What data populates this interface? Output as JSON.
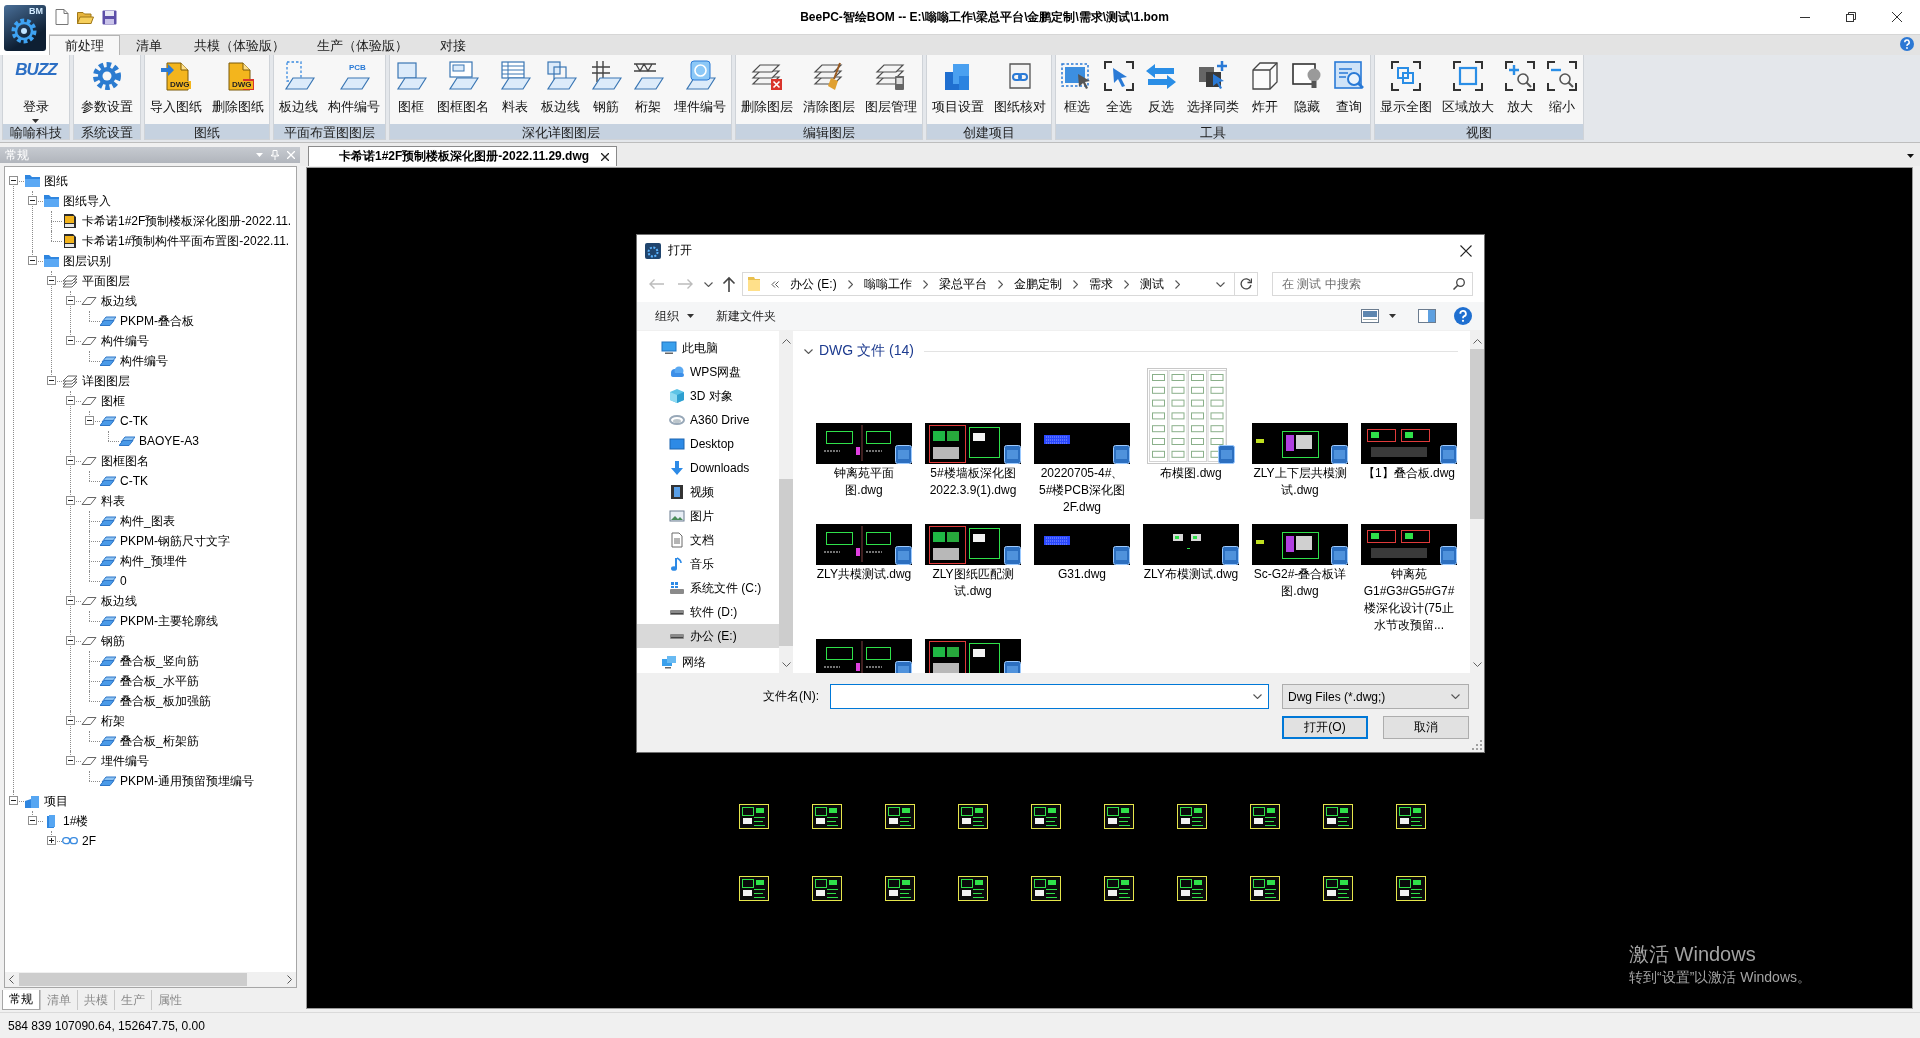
{
  "app": {
    "logo_text": "BM",
    "title": "BeePC-智绘BOM -- E:\\嗡嗡工作\\梁总平台\\金鹏定制\\需求\\测试\\1.bom"
  },
  "ribbon_tabs": [
    {
      "label": "前处理",
      "selected": true
    },
    {
      "label": "清单",
      "selected": false
    },
    {
      "label": "共模（体验版）",
      "selected": false
    },
    {
      "label": "生产（体验版）",
      "selected": false
    },
    {
      "label": "对接",
      "selected": false
    }
  ],
  "ribbon_groups": [
    {
      "label": "喻喻科技",
      "buttons": [
        {
          "label": "登录",
          "logo_text": "BUZZ",
          "menu": true
        }
      ]
    },
    {
      "label": "系统设置",
      "buttons": [
        {
          "label": "参数设置"
        }
      ]
    },
    {
      "label": "图纸",
      "buttons": [
        {
          "label": "导入图纸",
          "icon_text": "DWG"
        },
        {
          "label": "删除图纸",
          "icon_text": "DWG"
        }
      ]
    },
    {
      "label": "平面布置图图层",
      "buttons": [
        {
          "label": "板边线"
        },
        {
          "label": "构件编号",
          "icon_text": "PCB"
        }
      ]
    },
    {
      "label": "深化详图图层",
      "buttons": [
        {
          "label": "图框"
        },
        {
          "label": "图框图名"
        },
        {
          "label": "料表"
        },
        {
          "label": "板边线"
        },
        {
          "label": "钢筋"
        },
        {
          "label": "桁架"
        },
        {
          "label": "埋件编号"
        }
      ]
    },
    {
      "label": "编辑图层",
      "buttons": [
        {
          "label": "删除图层"
        },
        {
          "label": "清除图层"
        },
        {
          "label": "图层管理"
        }
      ]
    },
    {
      "label": "创建项目",
      "buttons": [
        {
          "label": "项目设置"
        },
        {
          "label": "图纸核对"
        }
      ]
    },
    {
      "label": "工具",
      "buttons": [
        {
          "label": "框选"
        },
        {
          "label": "全选"
        },
        {
          "label": "反选"
        },
        {
          "label": "选择同类"
        },
        {
          "label": "炸开"
        },
        {
          "label": "隐藏"
        },
        {
          "label": "查询"
        }
      ]
    },
    {
      "label": "视图",
      "buttons": [
        {
          "label": "显示全图"
        },
        {
          "label": "区域放大"
        },
        {
          "label": "放大"
        },
        {
          "label": "缩小"
        }
      ]
    }
  ],
  "side_panel": {
    "title": "常规",
    "tree": [
      {
        "label": "图纸",
        "kind": "folder",
        "expanded": true,
        "children": [
          {
            "label": "图纸导入",
            "kind": "folder",
            "expanded": true,
            "children": [
              {
                "label": "卡希诺1#2F预制楼板深化图册-2022.11.",
                "kind": "file"
              },
              {
                "label": "卡希诺1#预制构件平面布置图-2022.11.",
                "kind": "file"
              }
            ]
          },
          {
            "label": "图层识别",
            "kind": "folder",
            "expanded": true,
            "children": [
              {
                "label": "平面图层",
                "kind": "layer-set",
                "expanded": true,
                "children": [
                  {
                    "label": "板边线",
                    "kind": "category",
                    "expanded": true,
                    "children": [
                      {
                        "label": "PKPM-叠合板",
                        "kind": "layer"
                      }
                    ]
                  },
                  {
                    "label": "构件编号",
                    "kind": "category",
                    "expanded": true,
                    "children": [
                      {
                        "label": "构件编号",
                        "kind": "layer"
                      }
                    ]
                  }
                ]
              },
              {
                "label": "详图图层",
                "kind": "layer-set",
                "expanded": true,
                "children": [
                  {
                    "label": "图框",
                    "kind": "category",
                    "expanded": true,
                    "children": [
                      {
                        "label": "C-TK",
                        "kind": "layer",
                        "expanded": true,
                        "children": [
                          {
                            "label": "BAOYE-A3",
                            "kind": "layer"
                          }
                        ]
                      }
                    ]
                  },
                  {
                    "label": "图框图名",
                    "kind": "category",
                    "expanded": true,
                    "children": [
                      {
                        "label": "C-TK",
                        "kind": "layer"
                      }
                    ]
                  },
                  {
                    "label": "料表",
                    "kind": "category",
                    "expanded": true,
                    "children": [
                      {
                        "label": "构件_图表",
                        "kind": "layer"
                      },
                      {
                        "label": "PKPM-钢筋尺寸文字",
                        "kind": "layer"
                      },
                      {
                        "label": "构件_预埋件",
                        "kind": "layer"
                      },
                      {
                        "label": "0",
                        "kind": "layer"
                      }
                    ]
                  },
                  {
                    "label": "板边线",
                    "kind": "category",
                    "expanded": true,
                    "children": [
                      {
                        "label": "PKPM-主要轮廓线",
                        "kind": "layer"
                      }
                    ]
                  },
                  {
                    "label": "钢筋",
                    "kind": "category",
                    "expanded": true,
                    "children": [
                      {
                        "label": "叠合板_竖向筋",
                        "kind": "layer"
                      },
                      {
                        "label": "叠合板_水平筋",
                        "kind": "layer"
                      },
                      {
                        "label": "叠合板_板加强筋",
                        "kind": "layer"
                      }
                    ]
                  },
                  {
                    "label": "桁架",
                    "kind": "category",
                    "expanded": true,
                    "children": [
                      {
                        "label": "叠合板_桁架筋",
                        "kind": "layer"
                      }
                    ]
                  },
                  {
                    "label": "埋件编号",
                    "kind": "category",
                    "expanded": true,
                    "children": [
                      {
                        "label": "PKPM-通用预留预埋编号",
                        "kind": "layer"
                      }
                    ]
                  }
                ]
              }
            ]
          }
        ]
      },
      {
        "label": "项目",
        "kind": "project",
        "expanded": true,
        "children": [
          {
            "label": "1#楼",
            "kind": "building",
            "expanded": true,
            "children": [
              {
                "label": "2F",
                "kind": "floor",
                "expanded": false
              }
            ]
          }
        ]
      }
    ],
    "tabs": [
      {
        "label": "常规",
        "selected": true
      },
      {
        "label": "清单",
        "selected": false
      },
      {
        "label": "共模",
        "selected": false
      },
      {
        "label": "生产",
        "selected": false
      },
      {
        "label": "属性",
        "selected": false
      }
    ]
  },
  "document_tabs": [
    {
      "label": "卡希诺1#2F预制楼板深化图册-2022.11.29.dwg",
      "selected": true
    }
  ],
  "activation_notice": {
    "title": "激活 Windows",
    "hint": "转到“设置”以激活 Windows。"
  },
  "open_dialog": {
    "title": "打开",
    "breadcrumbs": [
      "办公 (E:)",
      "嗡嗡工作",
      "梁总平台",
      "金鹏定制",
      "需求",
      "测试"
    ],
    "search": {
      "placeholder": "在 测试 中搜索"
    },
    "toolbar": [
      {
        "label": "组织",
        "menu": true
      },
      {
        "label": "新建文件夹"
      }
    ],
    "navigation": [
      {
        "label": "此电脑",
        "selected": false,
        "children": [
          {
            "label": "WPS网盘",
            "selected": false
          },
          {
            "label": "3D 对象",
            "selected": false
          },
          {
            "label": "A360 Drive",
            "selected": false
          },
          {
            "label": "Desktop",
            "selected": false
          },
          {
            "label": "Downloads",
            "selected": false
          },
          {
            "label": "视频",
            "selected": false
          },
          {
            "label": "图片",
            "selected": false
          },
          {
            "label": "文档",
            "selected": false
          },
          {
            "label": "音乐",
            "selected": false
          },
          {
            "label": "系统文件 (C:)",
            "selected": false
          },
          {
            "label": "软件 (D:)",
            "selected": false
          },
          {
            "label": "办公 (E:)",
            "selected": true
          }
        ]
      },
      {
        "label": "网络",
        "selected": false
      }
    ],
    "group_header": "DWG 文件 (14)",
    "files": [
      {
        "name": "钟离苑平面图.dwg",
        "kind": "drawing"
      },
      {
        "name": "5#楼墙板深化图2022.3.9(1).dwg",
        "kind": "drawing"
      },
      {
        "name": "20220705-4#、5#楼PCB深化图2F.dwg",
        "kind": "drawing"
      },
      {
        "name": "布模图.dwg",
        "kind": "sheet"
      },
      {
        "name": "ZLY上下层共模测试.dwg",
        "kind": "drawing"
      },
      {
        "name": "【1】叠合板.dwg",
        "kind": "drawing"
      },
      {
        "name": "ZLY共模测试.dwg",
        "kind": "drawing"
      },
      {
        "name": "ZLY图纸匹配测试.dwg",
        "kind": "drawing"
      },
      {
        "name": "G31.dwg",
        "kind": "drawing"
      },
      {
        "name": "ZLY布模测试.dwg",
        "kind": "drawing"
      },
      {
        "name": "Sc-G2#-叠合板详图.dwg",
        "kind": "drawing"
      },
      {
        "name": "钟离苑G1#G3#G5#G7#楼深化设计(75止水节改预留...",
        "kind": "drawing"
      },
      {
        "kind": "drawing"
      },
      {
        "kind": "drawing"
      }
    ],
    "file_name": {
      "label": "文件名(N):"
    },
    "file_type": "Dwg Files (*.dwg;)",
    "buttons": [
      {
        "label": "打开(O)",
        "default": true
      },
      {
        "label": "取消",
        "default": false
      }
    ]
  },
  "status_bar": {
    "text": "584 839 107090.64, 152647.75, 0.00"
  }
}
